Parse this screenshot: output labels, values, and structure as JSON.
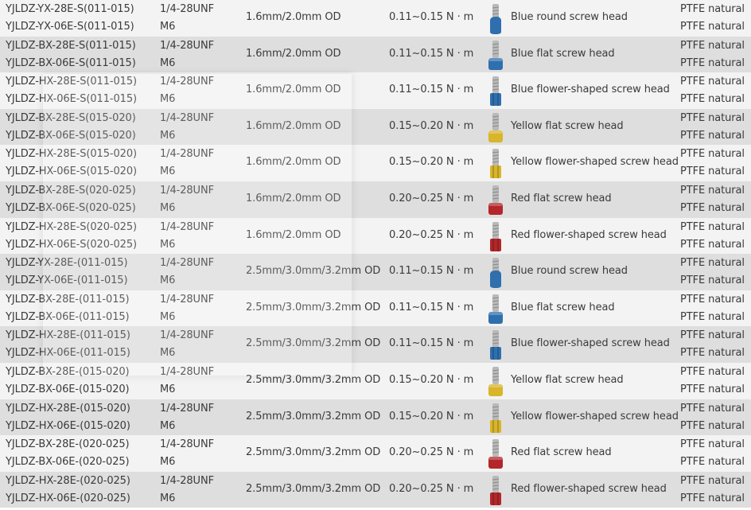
{
  "colors": {
    "blue": "#2f6fae",
    "yellow": "#d8b52a",
    "red": "#b3262a",
    "stem": "#b9b9b9"
  },
  "rows": [
    {
      "model_a": "YJLDZ-YX-28E-S(011-015)",
      "model_b": "YJLDZ-YX-06E-S(011-015)",
      "thread_a": "1/4-28UNF",
      "thread_b": "M6",
      "od": "1.6mm/2.0mm  OD",
      "torque": "0.11~0.15 N · m",
      "icon": "blue-round-screw-head-icon",
      "color": "blue",
      "head": "round",
      "desc": "Blue round screw head",
      "material_a": "PTFE natural",
      "material_b": "PTFE natural"
    },
    {
      "model_a": "YJLDZ-BX-28E-S(011-015)",
      "model_b": "YJLDZ-BX-06E-S(011-015)",
      "thread_a": "1/4-28UNF",
      "thread_b": "M6",
      "od": "1.6mm/2.0mm  OD",
      "torque": "0.11~0.15 N · m",
      "icon": "blue-flat-screw-head-icon",
      "color": "blue",
      "head": "flat",
      "desc": "Blue flat screw head",
      "material_a": "PTFE natural",
      "material_b": "PTFE natural"
    },
    {
      "model_a": "YJLDZ-HX-28E-S(011-015)",
      "model_b": "YJLDZ-HX-06E-S(011-015)",
      "thread_a": "1/4-28UNF",
      "thread_b": "M6",
      "od": "1.6mm/2.0mm  OD",
      "torque": "0.11~0.15 N · m",
      "icon": "blue-flower-screw-head-icon",
      "color": "blue",
      "head": "flower",
      "desc": "Blue flower-shaped screw head",
      "material_a": "PTFE natural",
      "material_b": "PTFE natural"
    },
    {
      "model_a": "YJLDZ-BX-28E-S(015-020)",
      "model_b": "YJLDZ-BX-06E-S(015-020)",
      "thread_a": "1/4-28UNF",
      "thread_b": "M6",
      "od": "1.6mm/2.0mm  OD",
      "torque": "0.15~0.20 N · m",
      "icon": "yellow-flat-screw-head-icon",
      "color": "yellow",
      "head": "flat",
      "desc": "Yellow flat screw head",
      "material_a": "PTFE natural",
      "material_b": "PTFE natural"
    },
    {
      "model_a": "YJLDZ-HX-28E-S(015-020)",
      "model_b": "YJLDZ-HX-06E-S(015-020)",
      "thread_a": "1/4-28UNF",
      "thread_b": "M6",
      "od": "1.6mm/2.0mm  OD",
      "torque": "0.15~0.20 N · m",
      "icon": "yellow-flower-screw-head-icon",
      "color": "yellow",
      "head": "flower",
      "desc": "Yellow flower-shaped screw head",
      "material_a": "PTFE natural",
      "material_b": "PTFE natural"
    },
    {
      "model_a": "YJLDZ-BX-28E-S(020-025)",
      "model_b": "YJLDZ-BX-06E-S(020-025)",
      "thread_a": "1/4-28UNF",
      "thread_b": "M6",
      "od": "1.6mm/2.0mm  OD",
      "torque": "0.20~0.25 N · m",
      "icon": "red-flat-screw-head-icon",
      "color": "red",
      "head": "flat",
      "desc": "Red flat screw head",
      "material_a": "PTFE natural",
      "material_b": "PTFE natural"
    },
    {
      "model_a": "YJLDZ-HX-28E-S(020-025)",
      "model_b": "YJLDZ-HX-06E-S(020-025)",
      "thread_a": "1/4-28UNF",
      "thread_b": "M6",
      "od": "1.6mm/2.0mm  OD",
      "torque": "0.20~0.25 N · m",
      "icon": "red-flower-screw-head-icon",
      "color": "red",
      "head": "flower",
      "desc": "Red flower-shaped screw head",
      "material_a": "PTFE natural",
      "material_b": "PTFE natural"
    },
    {
      "model_a": "YJLDZ-YX-28E-(011-015)",
      "model_b": "YJLDZ-YX-06E-(011-015)",
      "thread_a": "1/4-28UNF",
      "thread_b": "M6",
      "od": "2.5mm/3.0mm/3.2mm  OD",
      "torque": "0.11~0.15 N · m",
      "icon": "blue-round-screw-head-icon",
      "color": "blue",
      "head": "round",
      "desc": "Blue round screw head",
      "material_a": "PTFE natural",
      "material_b": "PTFE natural"
    },
    {
      "model_a": "YJLDZ-BX-28E-(011-015)",
      "model_b": "YJLDZ-BX-06E-(011-015)",
      "thread_a": "1/4-28UNF",
      "thread_b": "M6",
      "od": "2.5mm/3.0mm/3.2mm  OD",
      "torque": "0.11~0.15 N · m",
      "icon": "blue-flat-screw-head-icon",
      "color": "blue",
      "head": "flat",
      "desc": "Blue flat screw head",
      "material_a": "PTFE natural",
      "material_b": "PTFE natural"
    },
    {
      "model_a": "YJLDZ-HX-28E-(011-015)",
      "model_b": "YJLDZ-HX-06E-(011-015)",
      "thread_a": "1/4-28UNF",
      "thread_b": "M6",
      "od": "2.5mm/3.0mm/3.2mm  OD",
      "torque": "0.11~0.15 N · m",
      "icon": "blue-flower-screw-head-icon",
      "color": "blue",
      "head": "flower",
      "desc": "Blue flower-shaped screw head",
      "material_a": "PTFE natural",
      "material_b": "PTFE natural"
    },
    {
      "model_a": "YJLDZ-BX-28E-(015-020)",
      "model_b": "YJLDZ-BX-06E-(015-020)",
      "thread_a": "1/4-28UNF",
      "thread_b": "M6",
      "od": "2.5mm/3.0mm/3.2mm  OD",
      "torque": "0.15~0.20 N · m",
      "icon": "yellow-flat-screw-head-icon",
      "color": "yellow",
      "head": "flat",
      "desc": "Yellow flat screw head",
      "material_a": "PTFE natural",
      "material_b": "PTFE natural"
    },
    {
      "model_a": "YJLDZ-HX-28E-(015-020)",
      "model_b": "YJLDZ-HX-06E-(015-020)",
      "thread_a": "1/4-28UNF",
      "thread_b": "M6",
      "od": "2.5mm/3.0mm/3.2mm  OD",
      "torque": "0.15~0.20 N · m",
      "icon": "yellow-flower-screw-head-icon",
      "color": "yellow",
      "head": "flower",
      "desc": "Yellow flower-shaped screw head",
      "material_a": "PTFE natural",
      "material_b": "PTFE natural"
    },
    {
      "model_a": "YJLDZ-BX-28E-(020-025)",
      "model_b": "YJLDZ-BX-06E-(020-025)",
      "thread_a": "1/4-28UNF",
      "thread_b": "M6",
      "od": "2.5mm/3.0mm/3.2mm  OD",
      "torque": "0.20~0.25 N · m",
      "icon": "red-flat-screw-head-icon",
      "color": "red",
      "head": "flat",
      "desc": "Red flat screw head",
      "material_a": "PTFE natural",
      "material_b": "PTFE natural"
    },
    {
      "model_a": "YJLDZ-HX-28E-(020-025)",
      "model_b": "YJLDZ-HX-06E-(020-025)",
      "thread_a": "1/4-28UNF",
      "thread_b": "M6",
      "od": "2.5mm/3.0mm/3.2mm  OD",
      "torque": "0.20~0.25 N · m",
      "icon": "red-flower-screw-head-icon",
      "color": "red",
      "head": "flower",
      "desc": "Red flower-shaped screw head",
      "material_a": "PTFE natural",
      "material_b": "PTFE natural"
    }
  ]
}
